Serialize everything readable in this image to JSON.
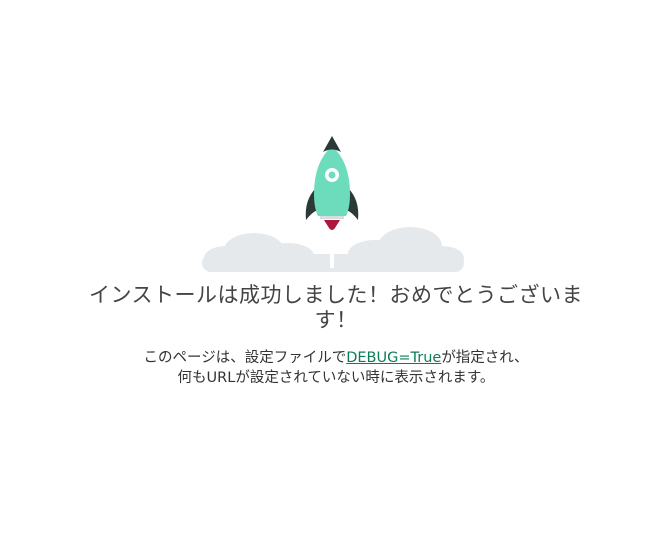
{
  "headline": "インストールは成功しました！おめでとうございます！",
  "body": {
    "line1_before": "このページは、設定ファイルで",
    "setting_link": "DEBUG=True",
    "line1_after": "が指定され、",
    "line2": "何もURLが設定されていない時に表示されます。"
  },
  "illustration": {
    "icon": "rocket-launch-icon",
    "rocket_color": "#6ddcbd",
    "fin_color": "#2b3a36",
    "flame_color": "#b0163c",
    "cloud_color": "#e6e9ec"
  },
  "colors": {
    "link": "#0c7c59",
    "headline": "#444444"
  }
}
